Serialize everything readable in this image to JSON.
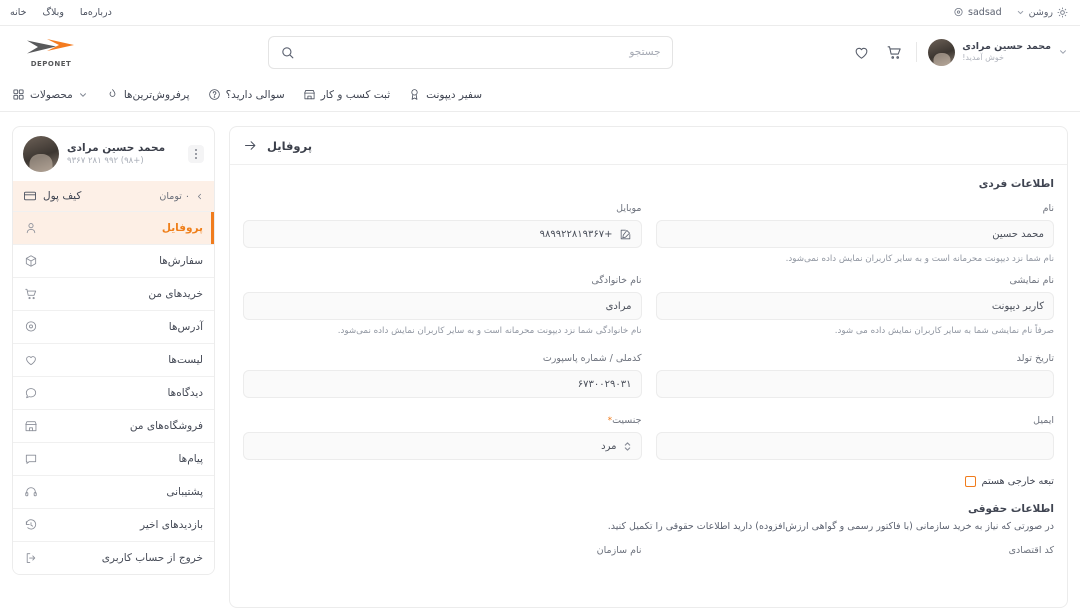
{
  "topbar": {
    "theme": {
      "label": "روشن",
      "icon": "sun-icon"
    },
    "location": {
      "label": "sadsad",
      "icon": "location-pin-icon"
    },
    "links": [
      {
        "label": "خانه"
      },
      {
        "label": "وبلاگ"
      },
      {
        "label": "درباره‌ما"
      }
    ]
  },
  "header": {
    "logo": {
      "text": "DEPONET",
      "icon": "deponet-logo-icon",
      "color": "#F47B20"
    },
    "search": {
      "placeholder": "جستجو",
      "value": "",
      "icon": "search-icon"
    },
    "wishlist_icon": "heart-icon",
    "cart_icon": "cart-icon",
    "user": {
      "name": "محمد حسین مرادی",
      "greeting": "خوش آمدید!",
      "chevron_icon": "chevron-down-icon",
      "avatar_icon": "avatar"
    }
  },
  "mainnav": {
    "items": [
      {
        "label": "محصولات",
        "icon": "grid-icon",
        "chevron": "chevron-down-icon"
      },
      {
        "label": "پرفروش‌ترین‌ها",
        "icon": "fire-icon"
      },
      {
        "label": "سوالی دارید؟",
        "icon": "question-circle-icon"
      },
      {
        "label": "ثبت کسب و کار",
        "icon": "store-icon"
      },
      {
        "label": "سفیر دیپونت",
        "icon": "medal-icon"
      }
    ]
  },
  "sidebar": {
    "user": {
      "name": "محمد حسین مرادی",
      "phone": "(+۹۸) ۹۹۲ ۲۸۱ ۹۳۶۷",
      "menu_icon": "kebab-menu-icon"
    },
    "wallet": {
      "label": "کیف پول",
      "amount": "۰ تومان",
      "icon": "wallet-card-icon",
      "chevron_icon": "chevron-left-icon"
    },
    "items": [
      {
        "label": "پروفایل",
        "icon": "user-icon",
        "active": true
      },
      {
        "label": "سفارش‌ها",
        "icon": "box-icon",
        "active": false
      },
      {
        "label": "خریدهای من",
        "icon": "cart-icon",
        "active": false
      },
      {
        "label": "آدرس‌ها",
        "icon": "location-pin-icon",
        "active": false
      },
      {
        "label": "لیست‌ها",
        "icon": "heart-icon",
        "active": false
      },
      {
        "label": "دیدگاه‌ها",
        "icon": "comment-icon",
        "active": false
      },
      {
        "label": "فروشگاه‌های من",
        "icon": "store-icon",
        "active": false
      },
      {
        "label": "پیام‌ها",
        "icon": "message-icon",
        "active": false
      },
      {
        "label": "پشتیبانی",
        "icon": "headset-icon",
        "active": false
      },
      {
        "label": "بازدیدهای اخیر",
        "icon": "history-icon",
        "active": false
      },
      {
        "label": "خروج از حساب کاربری",
        "icon": "logout-icon",
        "active": false
      }
    ]
  },
  "profile": {
    "title": "پروفایل",
    "back_icon": "arrow-left-icon",
    "personal_section": "اطلاعات فردی",
    "fields": {
      "mobile": {
        "label": "موبایل",
        "value": "+۹۸۹۹۲۲۸۱۹۳۶۷",
        "edit_icon": "edit-pencil-icon",
        "hint": ""
      },
      "first_name": {
        "label": "نام",
        "value": "محمد حسین",
        "hint": "نام شما نزد دیپونت محرمانه است و به سایر کاربران نمایش داده نمی‌شود."
      },
      "last_name": {
        "label": "نام خانوادگی",
        "value": "مرادی",
        "hint": "نام خانوادگی شما نزد دیپونت محرمانه است و به سایر کاربران نمایش داده نمی‌شود."
      },
      "display_name": {
        "label": "نام نمایشی",
        "value": "کاربر دیپونت",
        "hint": "صرفاً نام نمایشی شما به سایر کاربران نمایش داده می شود."
      },
      "national_id": {
        "label": "کدملی / شماره پاسپورت",
        "value": "۶۷۳۰۰۲۹۰۳۱",
        "hint": ""
      },
      "birth_date": {
        "label": "تاریخ تولد",
        "value": "",
        "hint": ""
      },
      "gender": {
        "label": "جنسیت",
        "required": "*",
        "value": "مرد",
        "stepper_icon": "select-stepper-icon",
        "hint": ""
      },
      "email": {
        "label": "ایمیل",
        "value": "",
        "hint": ""
      }
    },
    "foreign_checkbox": {
      "label": "تبعه خارجی هستم",
      "checked": false
    },
    "legal_section": {
      "title": "اطلاعات حقوقی",
      "description": "در صورتی که نیاز به خرید سازمانی (با فاکتور رسمی و گواهی ارزش‌افزوده) دارید اطلاعات حقوقی را تکمیل کنید.",
      "org_name_label": "نام سازمان",
      "econ_code_label": "کد اقتصادی"
    }
  },
  "colors": {
    "accent": "#F07C1D",
    "accent_soft": "#FDEFE5",
    "text": "#3F4451",
    "muted": "#9096A1",
    "border": "#ECECEC"
  }
}
